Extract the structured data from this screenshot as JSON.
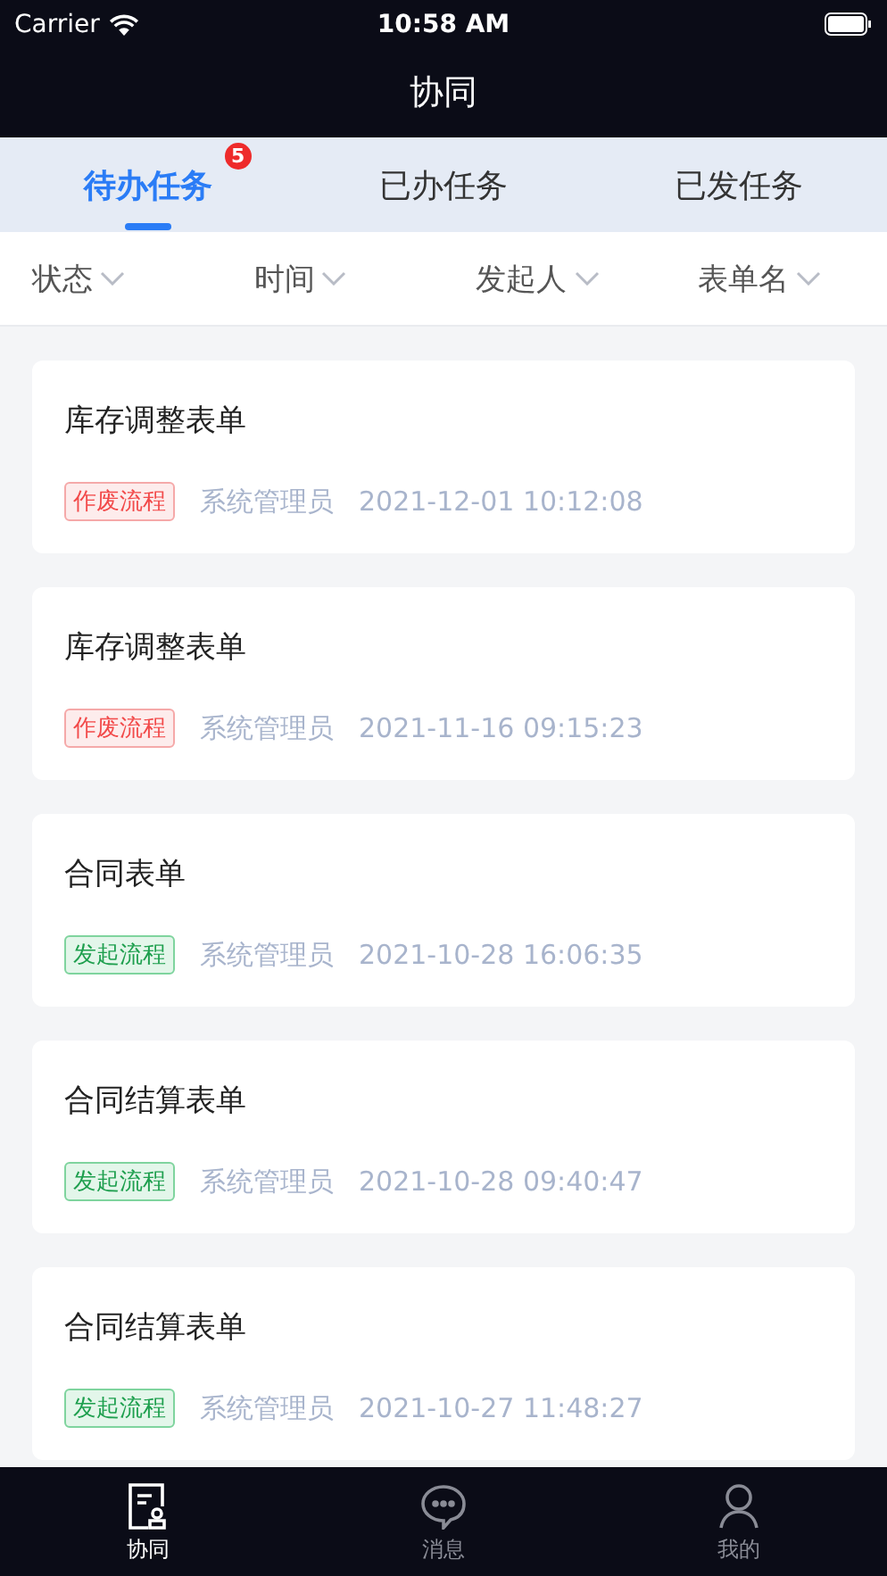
{
  "status_bar": {
    "carrier": "Carrier",
    "time": "10:58 AM"
  },
  "nav": {
    "title": "协同"
  },
  "tabs": [
    {
      "label": "待办任务",
      "selected": true,
      "badge": "5"
    },
    {
      "label": "已办任务",
      "selected": false
    },
    {
      "label": "已发任务",
      "selected": false
    }
  ],
  "filters": [
    "状态",
    "时间",
    "发起人",
    "表单名"
  ],
  "tasks": [
    {
      "title": "库存调整表单",
      "tag": "作废流程",
      "kind": "void",
      "sender": "系统管理员",
      "time": "2021-12-01 10:12:08"
    },
    {
      "title": "库存调整表单",
      "tag": "作废流程",
      "kind": "void",
      "sender": "系统管理员",
      "time": "2021-11-16 09:15:23"
    },
    {
      "title": "合同表单",
      "tag": "发起流程",
      "kind": "start",
      "sender": "系统管理员",
      "time": "2021-10-28 16:06:35"
    },
    {
      "title": "合同结算表单",
      "tag": "发起流程",
      "kind": "start",
      "sender": "系统管理员",
      "time": "2021-10-28 09:40:47"
    },
    {
      "title": "合同结算表单",
      "tag": "发起流程",
      "kind": "start",
      "sender": "系统管理员",
      "time": "2021-10-27 11:48:27"
    }
  ],
  "tab_bar": [
    {
      "label": "协同",
      "selected": true,
      "kind": "doc"
    },
    {
      "label": "消息",
      "selected": false,
      "kind": "chat"
    },
    {
      "label": "我的",
      "selected": false,
      "kind": "user"
    }
  ]
}
